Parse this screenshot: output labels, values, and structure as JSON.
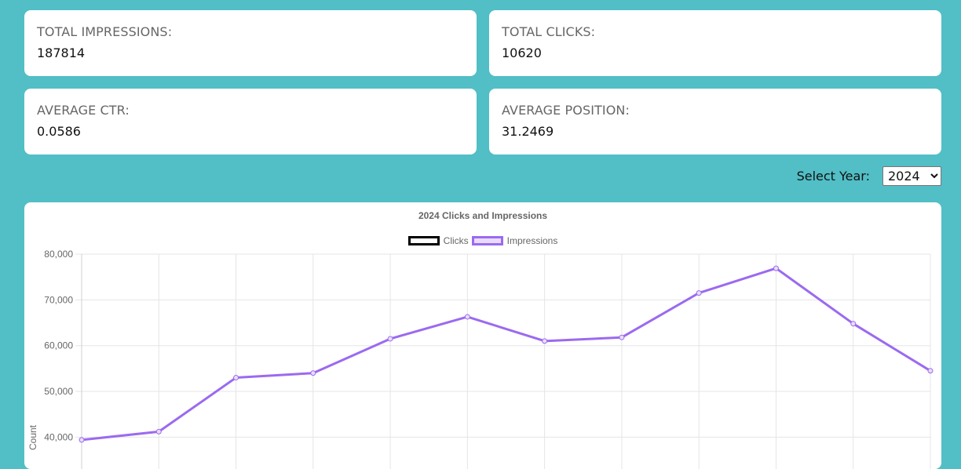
{
  "stats": {
    "impressions": {
      "label": "TOTAL IMPRESSIONS:",
      "value": "187814"
    },
    "clicks": {
      "label": "TOTAL CLICKS:",
      "value": "10620"
    },
    "ctr": {
      "label": "AVERAGE CTR:",
      "value": "0.0586"
    },
    "position": {
      "label": "AVERAGE POSITION:",
      "value": "31.2469"
    }
  },
  "year_selector": {
    "label": "Select Year:",
    "selected": "2024"
  },
  "colors": {
    "background": "#52bec6",
    "impressions_line": "#9b6af0",
    "clicks_line": "#000000"
  },
  "chart_data": {
    "type": "line",
    "title": "2024 Clicks and Impressions",
    "ylabel": "Count",
    "xlabel": "",
    "legend_position": "top",
    "grid": true,
    "ylim": [
      40000,
      80000
    ],
    "yticks": [
      "80,000",
      "70,000",
      "60,000",
      "50,000",
      "40,000"
    ],
    "yticks_values": [
      80000,
      70000,
      60000,
      50000,
      40000
    ],
    "series": [
      {
        "name": "Clicks",
        "color": "#000000",
        "values": []
      },
      {
        "name": "Impressions",
        "color": "#9b6af0",
        "values": [
          39400,
          41200,
          53000,
          54000,
          61500,
          66300,
          61000,
          61800,
          71500,
          76900,
          64800,
          54500
        ]
      }
    ]
  }
}
